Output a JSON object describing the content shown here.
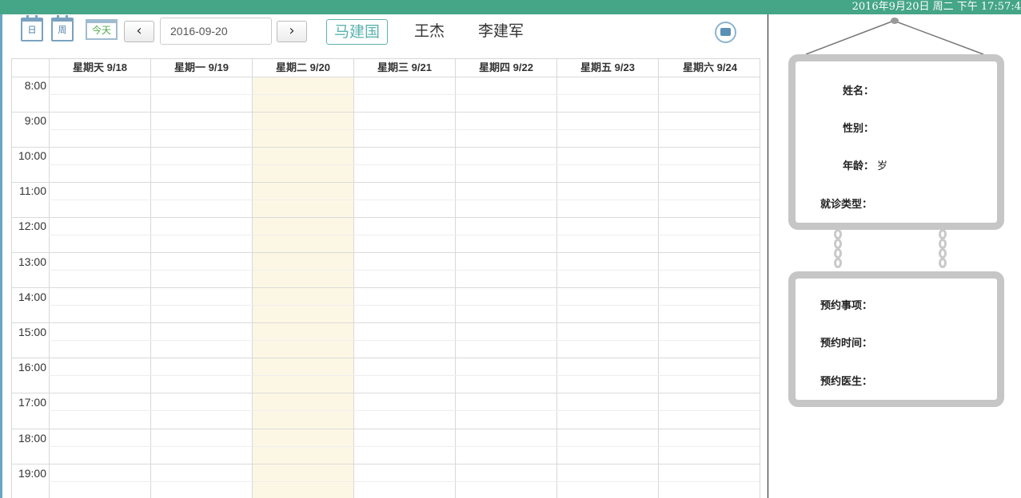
{
  "clock": "2016年9月20日 周二 下午 17:57:4",
  "toolbar": {
    "day_icon_label": "日",
    "week_icon_label": "周",
    "today_label": "今天",
    "prev_label": "‹",
    "next_label": "›",
    "date_value": "2016-09-20",
    "doctors": [
      "马建国",
      "王杰",
      "李建军"
    ],
    "active_doctor": "马建国"
  },
  "calendar": {
    "days": [
      "星期天 9/18",
      "星期一 9/19",
      "星期二 9/20",
      "星期三 9/21",
      "星期四 9/22",
      "星期五 9/23",
      "星期六 9/24"
    ],
    "today_index": 2,
    "hours": [
      "8:00",
      "9:00",
      "10:00",
      "11:00",
      "12:00",
      "13:00",
      "14:00",
      "15:00",
      "16:00",
      "17:00",
      "18:00",
      "19:00"
    ]
  },
  "patient": {
    "name_label": "姓名：",
    "gender_label": "性别：",
    "age_label": "年龄：",
    "age_unit": "岁",
    "visit_type_label": "就诊类型："
  },
  "appointment": {
    "item_label": "预约事项：",
    "time_label": "预约时间：",
    "doctor_label": "预约医生："
  },
  "colors": {
    "header_bar": "#45a587",
    "today_column": "#fcf7e4",
    "accent": "#5cb3b0"
  }
}
